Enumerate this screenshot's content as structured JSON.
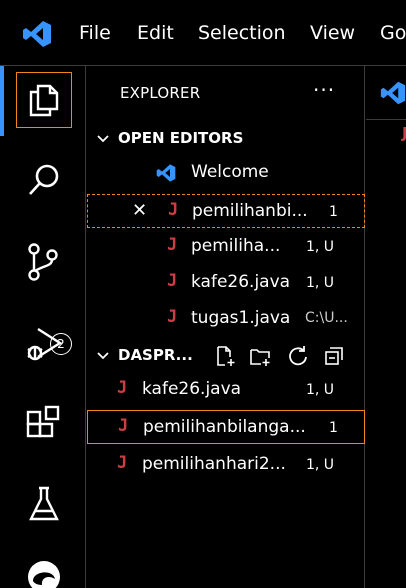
{
  "menu": {
    "items": [
      "File",
      "Edit",
      "Selection",
      "View",
      "Go"
    ]
  },
  "activity": {
    "scm_badge": "2"
  },
  "sidebar": {
    "title": "EXPLORER",
    "more": "···",
    "open_editors": {
      "label": "OPEN EDITORS",
      "items": [
        {
          "name": "Welcome",
          "status": "",
          "path": ""
        },
        {
          "name": "pemilihanbi...",
          "status": "1",
          "path": ""
        },
        {
          "name": "pemiliha...",
          "status": "1, U",
          "path": ""
        },
        {
          "name": "kafe26.java",
          "status": "1, U",
          "path": ""
        },
        {
          "name": "tugas1.java",
          "status": "",
          "path": "C:\\U..."
        }
      ]
    },
    "folder": {
      "label": "DASPR...",
      "files": [
        {
          "name": "kafe26.java",
          "status": "1, U"
        },
        {
          "name": "pemilihanbilanga...",
          "status": "1"
        },
        {
          "name": "pemilihanhari2...",
          "status": "1, U"
        }
      ]
    }
  },
  "icons": {
    "java": "J",
    "close": "✕"
  },
  "colors": {
    "accent_blue": "#3794ff",
    "focus_orange": "#f38518",
    "java_red": "#cc3e44"
  }
}
